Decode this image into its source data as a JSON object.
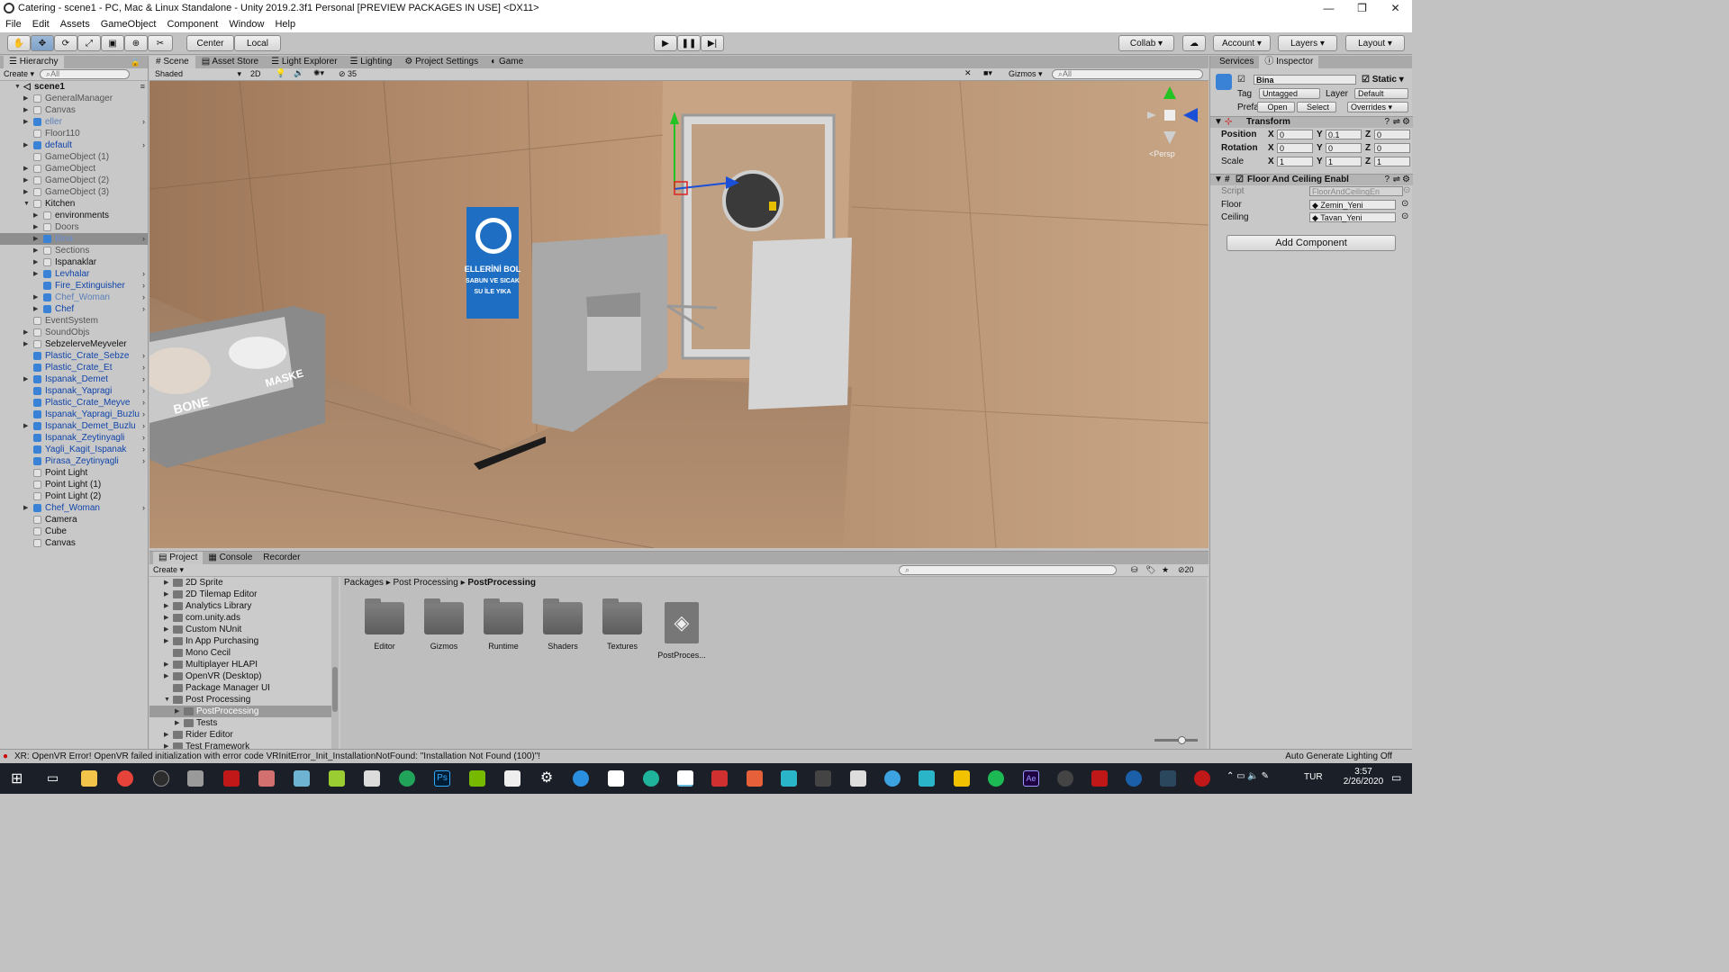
{
  "window": {
    "title": "Catering - scene1 - PC, Mac & Linux Standalone - Unity 2019.2.3f1 Personal [PREVIEW PACKAGES IN USE] <DX11>",
    "controls": [
      "—",
      "❐",
      "✕"
    ]
  },
  "menu": [
    "File",
    "Edit",
    "Assets",
    "GameObject",
    "Component",
    "Window",
    "Help"
  ],
  "toolbar": {
    "pivot": "Center",
    "space": "Local",
    "collab": "Collab ▾",
    "account": "Account",
    "layers": "Layers",
    "layout": "Layout",
    "play_icon": "play-icon",
    "pause_icon": "pause-icon",
    "step_icon": "step-icon"
  },
  "hierarchy": {
    "tab": "Hierarchy",
    "create": "Create ▾",
    "search_placeholder": "All",
    "scene": "scene1",
    "items": [
      {
        "label": "GeneralManager",
        "indent": 0,
        "arrow": true,
        "icon": "grey",
        "style": "dim"
      },
      {
        "label": "Canvas",
        "indent": 0,
        "arrow": true,
        "icon": "grey",
        "style": "dim"
      },
      {
        "label": "eller",
        "indent": 0,
        "arrow": true,
        "icon": "blue",
        "style": "dimblue",
        "more": true
      },
      {
        "label": "Floor110",
        "indent": 0,
        "arrow": false,
        "icon": "grey",
        "style": "dim"
      },
      {
        "label": "default",
        "indent": 0,
        "arrow": true,
        "icon": "blue",
        "style": "blue",
        "more": true
      },
      {
        "label": "GameObject (1)",
        "indent": 0,
        "arrow": false,
        "icon": "grey",
        "style": "dim"
      },
      {
        "label": "GameObject",
        "indent": 0,
        "arrow": true,
        "icon": "grey",
        "style": "dim"
      },
      {
        "label": "GameObject (2)",
        "indent": 0,
        "arrow": true,
        "icon": "grey",
        "style": "dim"
      },
      {
        "label": "GameObject (3)",
        "indent": 0,
        "arrow": true,
        "icon": "grey",
        "style": "dim"
      },
      {
        "label": "Kitchen",
        "indent": 0,
        "arrow": true,
        "icon": "grey",
        "style": "normal",
        "open": true
      },
      {
        "label": "environments",
        "indent": 1,
        "arrow": true,
        "icon": "grey",
        "style": "normal"
      },
      {
        "label": "Doors",
        "indent": 1,
        "arrow": true,
        "icon": "grey",
        "style": "dim"
      },
      {
        "label": "Bina",
        "indent": 1,
        "arrow": true,
        "icon": "blue",
        "style": "sel",
        "more": true
      },
      {
        "label": "Sections",
        "indent": 1,
        "arrow": true,
        "icon": "grey",
        "style": "dim"
      },
      {
        "label": "Ispanaklar",
        "indent": 1,
        "arrow": true,
        "icon": "grey",
        "style": "normal"
      },
      {
        "label": "Levhalar",
        "indent": 1,
        "arrow": true,
        "icon": "blue",
        "style": "blue",
        "more": true
      },
      {
        "label": "Fire_Extinguisher",
        "indent": 1,
        "arrow": false,
        "icon": "blue",
        "style": "blue",
        "more": true
      },
      {
        "label": "Chef_Woman",
        "indent": 1,
        "arrow": true,
        "icon": "blue",
        "style": "dimblue",
        "more": true
      },
      {
        "label": "Chef",
        "indent": 1,
        "arrow": true,
        "icon": "blue",
        "style": "blue",
        "more": true
      },
      {
        "label": "EventSystem",
        "indent": 0,
        "arrow": false,
        "icon": "grey",
        "style": "dim"
      },
      {
        "label": "SoundObjs",
        "indent": 0,
        "arrow": true,
        "icon": "grey",
        "style": "dim"
      },
      {
        "label": "SebzelerveMeyveler",
        "indent": 0,
        "arrow": true,
        "icon": "grey",
        "style": "normal"
      },
      {
        "label": "Plastic_Crate_Sebze",
        "indent": 0,
        "arrow": false,
        "icon": "blue",
        "style": "blue",
        "more": true
      },
      {
        "label": "Plastic_Crate_Et",
        "indent": 0,
        "arrow": false,
        "icon": "blue",
        "style": "blue",
        "more": true
      },
      {
        "label": "Ispanak_Demet",
        "indent": 0,
        "arrow": true,
        "icon": "blue",
        "style": "blue",
        "more": true
      },
      {
        "label": "Ispanak_Yapragi",
        "indent": 0,
        "arrow": false,
        "icon": "blue",
        "style": "blue",
        "more": true
      },
      {
        "label": "Plastic_Crate_Meyve",
        "indent": 0,
        "arrow": false,
        "icon": "blue",
        "style": "blue",
        "more": true
      },
      {
        "label": "Ispanak_Yapragi_Buzlu",
        "indent": 0,
        "arrow": false,
        "icon": "blue",
        "style": "blue",
        "more": true
      },
      {
        "label": "Ispanak_Demet_Buzlu",
        "indent": 0,
        "arrow": true,
        "icon": "blue",
        "style": "blue",
        "more": true
      },
      {
        "label": "Ispanak_Zeytinyagli",
        "indent": 0,
        "arrow": false,
        "icon": "blue",
        "style": "blue",
        "more": true
      },
      {
        "label": "Yagli_Kagit_Ispanak",
        "indent": 0,
        "arrow": false,
        "icon": "blue",
        "style": "blue",
        "more": true
      },
      {
        "label": "Pirasa_Zeytinyagli",
        "indent": 0,
        "arrow": false,
        "icon": "blue",
        "style": "blue",
        "more": true
      },
      {
        "label": "Point Light",
        "indent": 0,
        "arrow": false,
        "icon": "grey",
        "style": "normal"
      },
      {
        "label": "Point Light (1)",
        "indent": 0,
        "arrow": false,
        "icon": "grey",
        "style": "normal"
      },
      {
        "label": "Point Light (2)",
        "indent": 0,
        "arrow": false,
        "icon": "grey",
        "style": "normal"
      },
      {
        "label": "Chef_Woman",
        "indent": 0,
        "arrow": true,
        "icon": "blue",
        "style": "blue",
        "more": true
      },
      {
        "label": "Camera",
        "indent": 0,
        "arrow": false,
        "icon": "grey",
        "style": "normal"
      },
      {
        "label": "Cube",
        "indent": 0,
        "arrow": false,
        "icon": "grey",
        "style": "normal"
      },
      {
        "label": "Canvas",
        "indent": 0,
        "arrow": false,
        "icon": "grey",
        "style": "normal"
      }
    ]
  },
  "scene_tabs": [
    "Scene",
    "Asset Store",
    "Light Explorer",
    "Lighting",
    "Project Settings",
    "Game"
  ],
  "scene_toolbar": {
    "shading": "Shaded",
    "mode_2d": "2D",
    "hidden_count": "35",
    "gizmos": "Gizmos",
    "search_placeholder": "All",
    "persp": "<Persp"
  },
  "scene_signs": {
    "sign_text": "ELLERİNİ BOL SABUN VE SICAK SU İLE YIKA",
    "box_left": "BONE",
    "box_right": "MASKE"
  },
  "project": {
    "tabs": [
      "Project",
      "Console",
      "Recorder"
    ],
    "create": "Create ▾",
    "count": "20",
    "tree": [
      {
        "label": "2D Sprite",
        "indent": 0,
        "arrow": true
      },
      {
        "label": "2D Tilemap Editor",
        "indent": 0,
        "arrow": true
      },
      {
        "label": "Analytics Library",
        "indent": 0,
        "arrow": true
      },
      {
        "label": "com.unity.ads",
        "indent": 0,
        "arrow": true
      },
      {
        "label": "Custom NUnit",
        "indent": 0,
        "arrow": true
      },
      {
        "label": "In App Purchasing",
        "indent": 0,
        "arrow": true
      },
      {
        "label": "Mono Cecil",
        "indent": 0,
        "arrow": false
      },
      {
        "label": "Multiplayer HLAPI",
        "indent": 0,
        "arrow": true
      },
      {
        "label": "OpenVR (Desktop)",
        "indent": 0,
        "arrow": true
      },
      {
        "label": "Package Manager UI",
        "indent": 0,
        "arrow": false
      },
      {
        "label": "Post Processing",
        "indent": 0,
        "arrow": true,
        "open": true
      },
      {
        "label": "PostProcessing",
        "indent": 1,
        "arrow": true,
        "sel": true
      },
      {
        "label": "Tests",
        "indent": 1,
        "arrow": true
      },
      {
        "label": "Rider Editor",
        "indent": 0,
        "arrow": true
      },
      {
        "label": "Test Framework",
        "indent": 0,
        "arrow": true
      }
    ],
    "breadcrumb": [
      "Packages",
      "Post Processing",
      "PostProcessing"
    ],
    "assets": [
      {
        "label": "Editor",
        "kind": "folder"
      },
      {
        "label": "Gizmos",
        "kind": "folder"
      },
      {
        "label": "Runtime",
        "kind": "folder"
      },
      {
        "label": "Shaders",
        "kind": "folder"
      },
      {
        "label": "Textures",
        "kind": "folder"
      },
      {
        "label": "PostProces...",
        "kind": "unity"
      }
    ]
  },
  "inspector": {
    "tabs": [
      "Services",
      "Inspector"
    ],
    "object_name": "Bina",
    "static_label": "Static",
    "tag_label": "Tag",
    "tag_value": "Untagged",
    "layer_label": "Layer",
    "layer_value": "Default",
    "prefab_label": "Prefab",
    "prefab_open": "Open",
    "prefab_select": "Select",
    "prefab_overrides": "Overrides",
    "transform": {
      "title": "Transform",
      "position_label": "Position",
      "rotation_label": "Rotation",
      "scale_label": "Scale",
      "position": {
        "x": "0",
        "y": "0.1",
        "z": "0"
      },
      "rotation": {
        "x": "0",
        "y": "0",
        "z": "0"
      },
      "scale": {
        "x": "1",
        "y": "1",
        "z": "1"
      }
    },
    "component": {
      "title": "Floor And Ceiling Enabl",
      "script_label": "Script",
      "script_value": "FloorAndCeilingEn",
      "floor_label": "Floor",
      "floor_value": "Zemin_Yeni",
      "ceiling_label": "Ceiling",
      "ceiling_value": "Tavan_Yeni"
    },
    "add_component": "Add Component"
  },
  "status": {
    "message": "XR: OpenVR Error! OpenVR failed initialization with error code VRInitError_Init_InstallationNotFound: \"Installation Not Found (100)\"!",
    "right": "Auto Generate Lighting Off"
  },
  "taskbar": {
    "lang": "TUR",
    "time": "3:57",
    "date": "2/26/2020"
  }
}
